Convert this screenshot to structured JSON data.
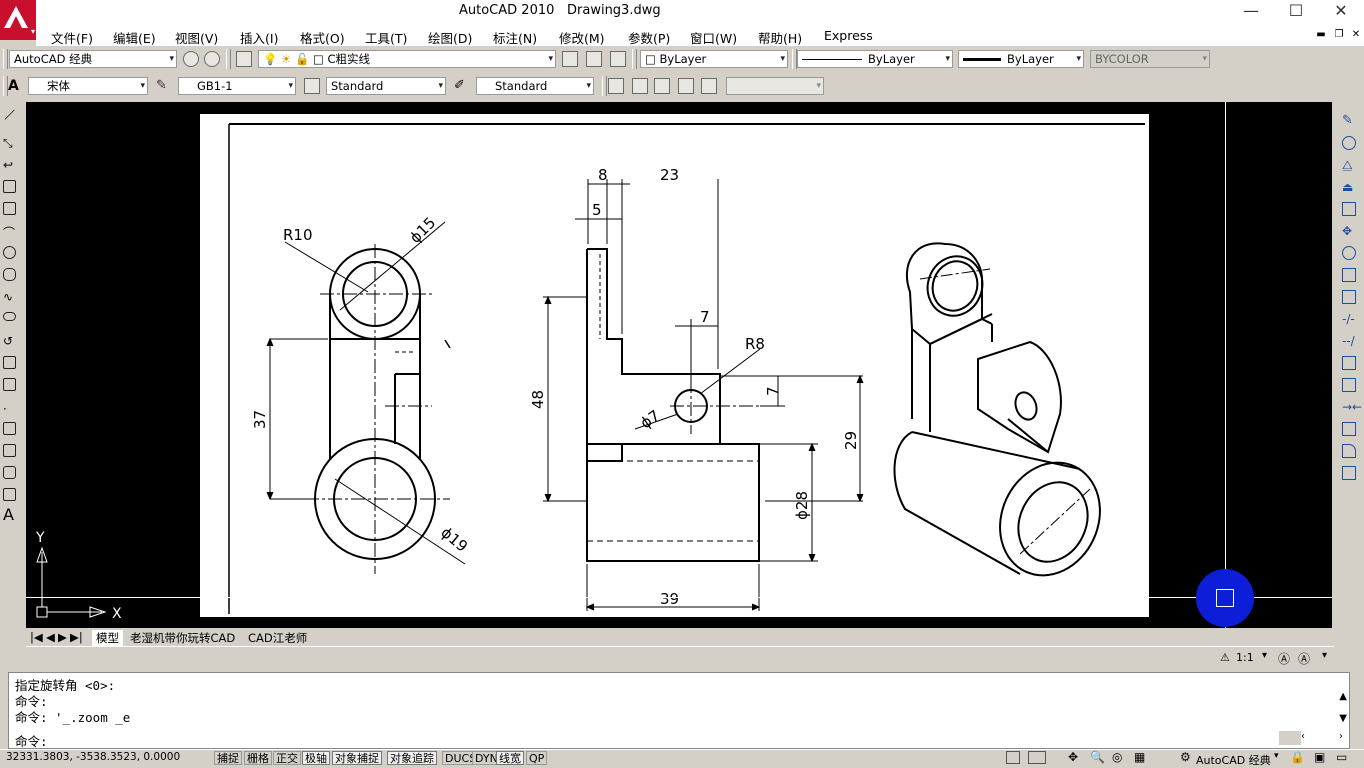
{
  "window": {
    "app_title": "AutoCAD 2010",
    "file_name": "Drawing3.dwg",
    "minimize": "—",
    "maximize": "☐",
    "close": "✕"
  },
  "menu": [
    "文件(F)",
    "编辑(E)",
    "视图(V)",
    "插入(I)",
    "格式(O)",
    "工具(T)",
    "绘图(D)",
    "标注(N)",
    "修改(M)",
    "参数(P)",
    "窗口(W)",
    "帮助(H)",
    "Express"
  ],
  "toolbar1": {
    "workspace": "AutoCAD 经典",
    "layer": "C粗实线",
    "color": "ByLayer",
    "linetype": "ByLayer",
    "lineweight": "ByLayer",
    "plotstyle": "BYCOLOR"
  },
  "toolbar2": {
    "text_font": "宋体",
    "dim_style": "GB1-1",
    "text_style": "Standard",
    "table_style": "Standard",
    "extra": ""
  },
  "drawing": {
    "front": {
      "r10": "R10",
      "d15": "ϕ15",
      "dim37": "37",
      "d19": "ϕ19"
    },
    "side": {
      "dim8": "8",
      "dim23": "23",
      "dim5": "5",
      "dim7a": "7",
      "r8": "R8",
      "dim48": "48",
      "d7": "ϕ7",
      "dim7b": "7",
      "dim29": "29",
      "d28": "ϕ28",
      "dim39": "39"
    },
    "ucs_x": "X",
    "ucs_y": "Y"
  },
  "tabs": {
    "model": "模型",
    "layout1": "老湿机带你玩转CAD",
    "layout2": "CAD江老师"
  },
  "annotation_scale": "1:1",
  "command": {
    "line1": "指定旋转角 <0>:",
    "line2": "命令:",
    "line3": "命令: '_.zoom _e",
    "prompt": "命令:"
  },
  "statusbar": {
    "coords": "32331.3803, -3538.3523, 0.0000",
    "toggles": [
      "捕捉",
      "栅格",
      "正交",
      "极轴",
      "对象捕捉",
      "对象追踪",
      "DUCS",
      "DYN",
      "线宽",
      "QP"
    ],
    "workspace": "AutoCAD 经典"
  }
}
